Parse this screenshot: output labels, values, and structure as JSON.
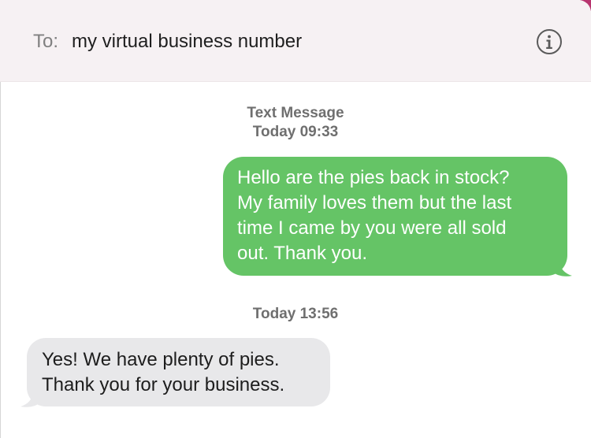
{
  "header": {
    "to_label": "To:",
    "recipient": "my virtual business number",
    "info_icon": "info-circle-icon"
  },
  "conversation": {
    "service_label": "Text Message",
    "timestamp_1": "Today 09:33",
    "timestamp_2": "Today 13:56",
    "messages": [
      {
        "direction": "outgoing",
        "lines": [
          "Hello are the pies back in stock?",
          "My family loves them but the last",
          "time I came by you were all sold",
          "out. Thank you."
        ]
      },
      {
        "direction": "incoming",
        "lines": [
          "Yes! We have plenty of pies.",
          "Thank you for your business."
        ]
      }
    ]
  },
  "colors": {
    "outgoing_bubble": "#65c466",
    "incoming_bubble": "#e8e8ea",
    "header_background": "#f6f1f3",
    "accent": "#b8356f"
  }
}
